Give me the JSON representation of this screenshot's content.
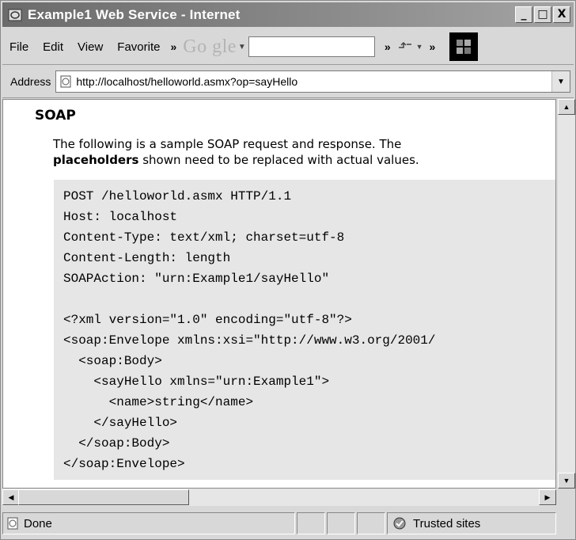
{
  "window": {
    "title": "Example1 Web Service - Internet",
    "controls": {
      "minimize": "_",
      "maximize": "□",
      "close": "X"
    }
  },
  "menubar": {
    "items": [
      "File",
      "Edit",
      "View",
      "Favorite"
    ],
    "overflow_glyph": "»",
    "google_logo": "Go  gle",
    "google_search_value": ""
  },
  "address": {
    "label": "Address",
    "url": "http://localhost/helloworld.asmx?op=sayHello"
  },
  "content": {
    "heading": "SOAP",
    "intro_line1": "The following is a sample SOAP request and response. The",
    "intro_bold": "placeholders",
    "intro_line2_rest": " shown need to be replaced with actual values.",
    "code_lines": [
      "POST /helloworld.asmx HTTP/1.1",
      "Host: localhost",
      "Content-Type: text/xml; charset=utf-8",
      "Content-Length: length",
      "SOAPAction: \"urn:Example1/sayHello\"",
      "",
      "<?xml version=\"1.0\" encoding=\"utf-8\"?>",
      "<soap:Envelope xmlns:xsi=\"http://www.w3.org/2001/",
      "  <soap:Body>",
      "    <sayHello xmlns=\"urn:Example1\">",
      "      <name>string</name>",
      "    </sayHello>",
      "  </soap:Body>",
      "</soap:Envelope>"
    ]
  },
  "status": {
    "text": "Done",
    "zone": "Trusted sites"
  }
}
